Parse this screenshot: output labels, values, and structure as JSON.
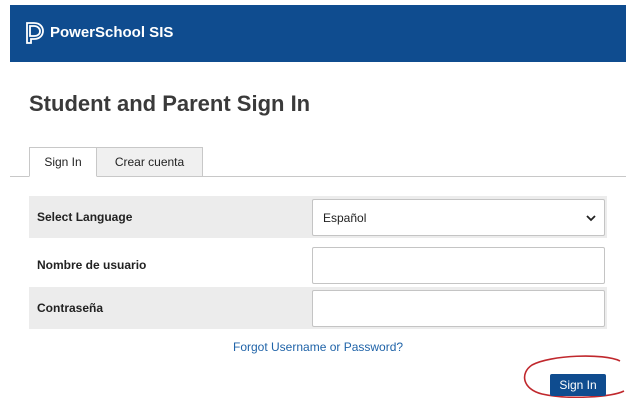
{
  "header": {
    "app_name": "PowerSchool SIS",
    "brand_color": "#0f4c8f",
    "logo_icon": "powerschool-logo-icon"
  },
  "page_title": "Student and Parent Sign In",
  "tabs": [
    {
      "label": "Sign In",
      "active": true
    },
    {
      "label": "Crear cuenta",
      "active": false
    }
  ],
  "form": {
    "language": {
      "label": "Select Language",
      "value": "Español",
      "icon": "chevron-down-icon"
    },
    "username": {
      "label": "Nombre de usuario",
      "value": ""
    },
    "password": {
      "label": "Contraseña",
      "value": ""
    }
  },
  "forgot_link": "Forgot Username or Password?",
  "sign_in_button": "Sign In",
  "annotation": {
    "shape": "circle",
    "color": "#c0282d"
  }
}
